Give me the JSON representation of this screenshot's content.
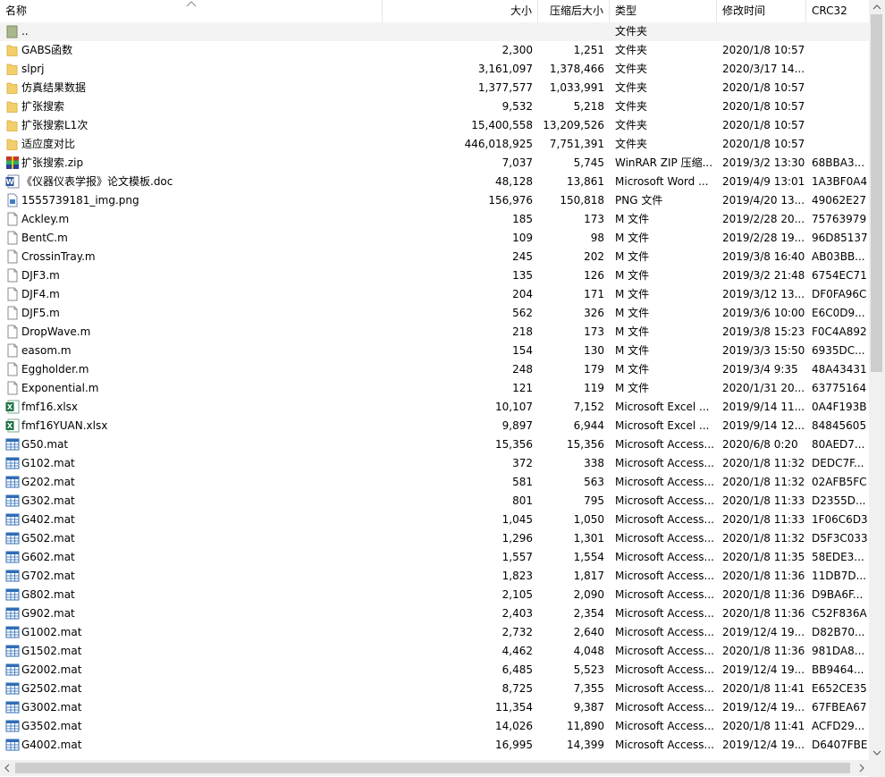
{
  "columns": {
    "name": "名称",
    "size": "大小",
    "packed": "压缩后大小",
    "type": "类型",
    "modified": "修改时间",
    "crc": "CRC32"
  },
  "files": [
    {
      "name": "..",
      "size": "",
      "packed": "",
      "type": "文件夹",
      "modified": "",
      "crc": "",
      "icon": "parent-folder"
    },
    {
      "name": "GABS函数",
      "size": "2,300",
      "packed": "1,251",
      "type": "文件夹",
      "modified": "2020/1/8 10:57",
      "crc": "",
      "icon": "folder"
    },
    {
      "name": "slprj",
      "size": "3,161,097",
      "packed": "1,378,466",
      "type": "文件夹",
      "modified": "2020/3/17 14...",
      "crc": "",
      "icon": "folder"
    },
    {
      "name": "仿真结果数据",
      "size": "1,377,577",
      "packed": "1,033,991",
      "type": "文件夹",
      "modified": "2020/1/8 10:57",
      "crc": "",
      "icon": "folder"
    },
    {
      "name": "扩张搜索",
      "size": "9,532",
      "packed": "5,218",
      "type": "文件夹",
      "modified": "2020/1/8 10:57",
      "crc": "",
      "icon": "folder"
    },
    {
      "name": "扩张搜索L1次",
      "size": "15,400,558",
      "packed": "13,209,526",
      "type": "文件夹",
      "modified": "2020/1/8 10:57",
      "crc": "",
      "icon": "folder"
    },
    {
      "name": "适应度对比",
      "size": "446,018,925",
      "packed": "7,751,391",
      "type": "文件夹",
      "modified": "2020/1/8 10:57",
      "crc": "",
      "icon": "folder"
    },
    {
      "name": "扩张搜索.zip",
      "size": "7,037",
      "packed": "5,745",
      "type": "WinRAR ZIP 压缩...",
      "modified": "2019/3/2 13:30",
      "crc": "68BBA3...",
      "icon": "zip"
    },
    {
      "name": "《仪器仪表学报》论文模板.doc",
      "size": "48,128",
      "packed": "13,861",
      "type": "Microsoft Word ...",
      "modified": "2019/4/9 13:01",
      "crc": "1A3BF0A4",
      "icon": "word"
    },
    {
      "name": "1555739181_img.png",
      "size": "156,976",
      "packed": "150,818",
      "type": "PNG 文件",
      "modified": "2019/4/20 13...",
      "crc": "49062E27",
      "icon": "png"
    },
    {
      "name": "Ackley.m",
      "size": "185",
      "packed": "173",
      "type": "M 文件",
      "modified": "2019/2/28 20...",
      "crc": "75763979",
      "icon": "file"
    },
    {
      "name": "BentC.m",
      "size": "109",
      "packed": "98",
      "type": "M 文件",
      "modified": "2019/2/28 19...",
      "crc": "96D85137",
      "icon": "file"
    },
    {
      "name": "CrossinTray.m",
      "size": "245",
      "packed": "202",
      "type": "M 文件",
      "modified": "2019/3/8 16:40",
      "crc": "AB03BB...",
      "icon": "file"
    },
    {
      "name": "DJF3.m",
      "size": "135",
      "packed": "126",
      "type": "M 文件",
      "modified": "2019/3/2 21:48",
      "crc": "6754EC71",
      "icon": "file"
    },
    {
      "name": "DJF4.m",
      "size": "204",
      "packed": "171",
      "type": "M 文件",
      "modified": "2019/3/12 13...",
      "crc": "DF0FA96C",
      "icon": "file"
    },
    {
      "name": "DJF5.m",
      "size": "562",
      "packed": "326",
      "type": "M 文件",
      "modified": "2019/3/6 10:00",
      "crc": "E6C0D9...",
      "icon": "file"
    },
    {
      "name": "DropWave.m",
      "size": "218",
      "packed": "173",
      "type": "M 文件",
      "modified": "2019/3/8 15:23",
      "crc": "F0C4A892",
      "icon": "file"
    },
    {
      "name": "easom.m",
      "size": "154",
      "packed": "130",
      "type": "M 文件",
      "modified": "2019/3/3 15:50",
      "crc": "6935DC...",
      "icon": "file"
    },
    {
      "name": "Eggholder.m",
      "size": "248",
      "packed": "179",
      "type": "M 文件",
      "modified": "2019/3/4 9:35",
      "crc": "48A43431",
      "icon": "file"
    },
    {
      "name": "Exponential.m",
      "size": "121",
      "packed": "119",
      "type": "M 文件",
      "modified": "2020/1/31 20...",
      "crc": "63775164",
      "icon": "file"
    },
    {
      "name": "fmf16.xlsx",
      "size": "10,107",
      "packed": "7,152",
      "type": "Microsoft Excel ...",
      "modified": "2019/9/14 11...",
      "crc": "0A4F193B",
      "icon": "excel"
    },
    {
      "name": "fmf16YUAN.xlsx",
      "size": "9,897",
      "packed": "6,944",
      "type": "Microsoft Excel ...",
      "modified": "2019/9/14 12...",
      "crc": "84845605",
      "icon": "excel"
    },
    {
      "name": "G50.mat",
      "size": "15,356",
      "packed": "15,356",
      "type": "Microsoft Access...",
      "modified": "2020/6/8 0:20",
      "crc": "80AED7...",
      "icon": "mat"
    },
    {
      "name": "G102.mat",
      "size": "372",
      "packed": "338",
      "type": "Microsoft Access...",
      "modified": "2020/1/8 11:32",
      "crc": "DEDC7F...",
      "icon": "mat"
    },
    {
      "name": "G202.mat",
      "size": "581",
      "packed": "563",
      "type": "Microsoft Access...",
      "modified": "2020/1/8 11:32",
      "crc": "02AFB5FC",
      "icon": "mat"
    },
    {
      "name": "G302.mat",
      "size": "801",
      "packed": "795",
      "type": "Microsoft Access...",
      "modified": "2020/1/8 11:33",
      "crc": "D2355D...",
      "icon": "mat"
    },
    {
      "name": "G402.mat",
      "size": "1,045",
      "packed": "1,050",
      "type": "Microsoft Access...",
      "modified": "2020/1/8 11:33",
      "crc": "1F06C6D3",
      "icon": "mat"
    },
    {
      "name": "G502.mat",
      "size": "1,296",
      "packed": "1,301",
      "type": "Microsoft Access...",
      "modified": "2020/1/8 11:32",
      "crc": "D5F3C033",
      "icon": "mat"
    },
    {
      "name": "G602.mat",
      "size": "1,557",
      "packed": "1,554",
      "type": "Microsoft Access...",
      "modified": "2020/1/8 11:35",
      "crc": "58EDE3...",
      "icon": "mat"
    },
    {
      "name": "G702.mat",
      "size": "1,823",
      "packed": "1,817",
      "type": "Microsoft Access...",
      "modified": "2020/1/8 11:36",
      "crc": "11DB7D...",
      "icon": "mat"
    },
    {
      "name": "G802.mat",
      "size": "2,105",
      "packed": "2,090",
      "type": "Microsoft Access...",
      "modified": "2020/1/8 11:36",
      "crc": "D9BA6F...",
      "icon": "mat"
    },
    {
      "name": "G902.mat",
      "size": "2,403",
      "packed": "2,354",
      "type": "Microsoft Access...",
      "modified": "2020/1/8 11:36",
      "crc": "C52F836A",
      "icon": "mat"
    },
    {
      "name": "G1002.mat",
      "size": "2,732",
      "packed": "2,640",
      "type": "Microsoft Access...",
      "modified": "2019/12/4 19...",
      "crc": "D82B70...",
      "icon": "mat"
    },
    {
      "name": "G1502.mat",
      "size": "4,462",
      "packed": "4,048",
      "type": "Microsoft Access...",
      "modified": "2020/1/8 11:36",
      "crc": "981DA8...",
      "icon": "mat"
    },
    {
      "name": "G2002.mat",
      "size": "6,485",
      "packed": "5,523",
      "type": "Microsoft Access...",
      "modified": "2019/12/4 19...",
      "crc": "BB9464...",
      "icon": "mat"
    },
    {
      "name": "G2502.mat",
      "size": "8,725",
      "packed": "7,355",
      "type": "Microsoft Access...",
      "modified": "2020/1/8 11:41",
      "crc": "E652CE35",
      "icon": "mat"
    },
    {
      "name": "G3002.mat",
      "size": "11,354",
      "packed": "9,387",
      "type": "Microsoft Access...",
      "modified": "2019/12/4 19...",
      "crc": "67FBEA67",
      "icon": "mat"
    },
    {
      "name": "G3502.mat",
      "size": "14,026",
      "packed": "11,890",
      "type": "Microsoft Access...",
      "modified": "2020/1/8 11:41",
      "crc": "ACFD29...",
      "icon": "mat"
    },
    {
      "name": "G4002.mat",
      "size": "16,995",
      "packed": "14,399",
      "type": "Microsoft Access...",
      "modified": "2019/12/4 19...",
      "crc": "D6407FBE",
      "icon": "mat"
    }
  ],
  "colors": {
    "folder": "#f3cf6b",
    "selected_row": "#f3f3f3",
    "excel": "#1e7145",
    "word": "#2b579a",
    "mat": "#2f6db5"
  }
}
